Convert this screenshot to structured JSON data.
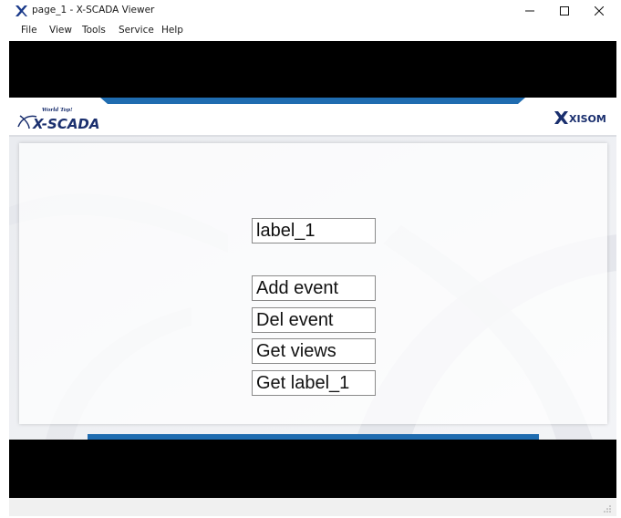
{
  "window": {
    "title": "page_1 - X-SCADA Viewer",
    "icon": "x-scada-app-icon",
    "controls": [
      "minimize-icon",
      "maximize-icon",
      "close-icon"
    ]
  },
  "menu": {
    "items": [
      {
        "label": "File"
      },
      {
        "label": "View"
      },
      {
        "label": "Tools"
      },
      {
        "label": "Service"
      },
      {
        "label": "Help"
      }
    ]
  },
  "header": {
    "left_logo": {
      "text": "X-SCADA",
      "tagline": "World Top!"
    },
    "right_logo": {
      "text": "XISOM"
    }
  },
  "panel": {
    "label_1": "label_1",
    "buttons": [
      {
        "label": "Add event"
      },
      {
        "label": "Del event"
      },
      {
        "label": "Get views"
      },
      {
        "label": "Get label_1"
      }
    ]
  },
  "colors": {
    "accent_blue": "#1f6cb0",
    "logo_navy": "#1a2f6e",
    "bands": "#000000"
  }
}
